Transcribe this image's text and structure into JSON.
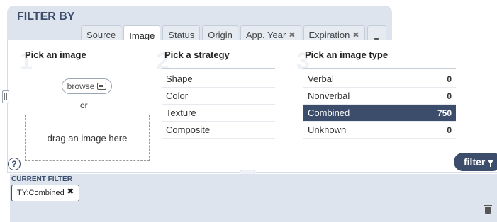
{
  "header": {
    "title": "FILTER BY"
  },
  "tabs": [
    {
      "label": "Source",
      "closable": false,
      "active": false
    },
    {
      "label": "Image",
      "closable": false,
      "active": true
    },
    {
      "label": "Status",
      "closable": false,
      "active": false
    },
    {
      "label": "Origin",
      "closable": false,
      "active": false
    },
    {
      "label": "App. Year",
      "closable": true,
      "active": false
    },
    {
      "label": "Expiration",
      "closable": true,
      "active": false
    }
  ],
  "tabs_close_glyph": "✖",
  "columns": {
    "image": {
      "number": "1",
      "header": "Pick an image",
      "browse_label": "browse",
      "or_text": "or",
      "drop_text": "drag an image here"
    },
    "strategy": {
      "number": "2",
      "header": "Pick a strategy",
      "items": [
        "Shape",
        "Color",
        "Texture",
        "Composite"
      ]
    },
    "type": {
      "number": "3",
      "header": "Pick an image type",
      "items": [
        {
          "label": "Verbal",
          "count": "0",
          "selected": false
        },
        {
          "label": "Nonverbal",
          "count": "0",
          "selected": false
        },
        {
          "label": "Combined",
          "count": "750",
          "selected": true
        },
        {
          "label": "Unknown",
          "count": "0",
          "selected": false
        }
      ]
    }
  },
  "help": {
    "label": "?"
  },
  "filter_button": {
    "label": "filter"
  },
  "current_filter": {
    "title": "CURRENT FILTER",
    "chip": {
      "label": "ITY:Combined",
      "close": "✖"
    }
  },
  "colors": {
    "accent": "#3b4d6b",
    "panel": "#dde4ee"
  },
  "icons": [
    "image-icon",
    "close-icon",
    "chevron-down-icon",
    "help-icon",
    "funnel-icon",
    "trash-icon",
    "drag-handle-icon"
  ]
}
